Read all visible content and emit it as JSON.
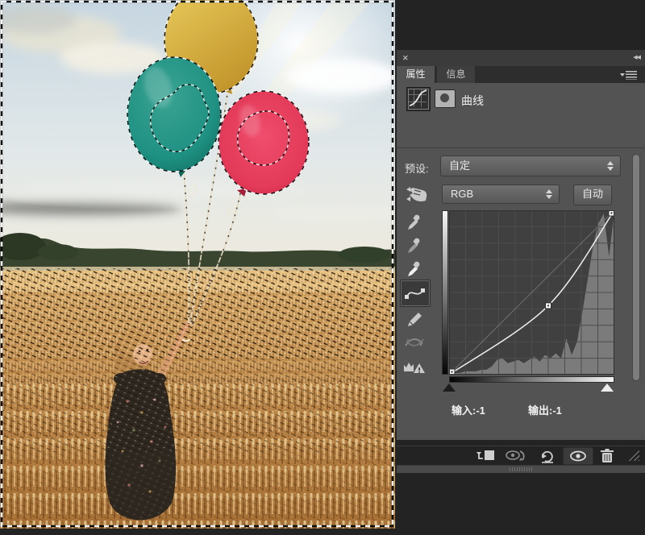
{
  "icons": {
    "close": "×",
    "collapse": "◀◀"
  },
  "tabs": {
    "properties": "属性",
    "info": "信息"
  },
  "panel": {
    "adjustment_title": "曲线",
    "preset_label": "预设:",
    "preset_value": "自定",
    "channel_value": "RGB",
    "auto_button": "自动",
    "input_label": "输入:",
    "input_value": "-1",
    "output_label": "输出:",
    "output_value": "-1"
  },
  "colors": {
    "panel_bg": "#535353",
    "canvas_bg": "#232323",
    "plot_bg": "#404040",
    "grid_line": "#4d4d4d",
    "histogram": "#7b7b7b",
    "curve": "#f0f0f0",
    "balloon_yellow": "#d5a937",
    "balloon_teal": "#1f9183",
    "balloon_red": "#e23a58"
  },
  "curves": {
    "channel": "RGB",
    "grid_divisions": 10,
    "points": [
      [
        0,
        0
      ],
      [
        153,
        107
      ],
      [
        255,
        255
      ]
    ],
    "histogram": [
      0.01,
      0.01,
      0.01,
      0.02,
      0.02,
      0.02,
      0.03,
      0.03,
      0.05,
      0.09,
      0.1,
      0.07,
      0.08,
      0.09,
      0.07,
      0.09,
      0.11,
      0.08,
      0.12,
      0.1,
      0.13,
      0.1,
      0.22,
      0.12,
      0.2,
      0.38,
      0.58,
      0.78,
      0.92,
      0.98,
      0.72,
      0.99
    ]
  }
}
